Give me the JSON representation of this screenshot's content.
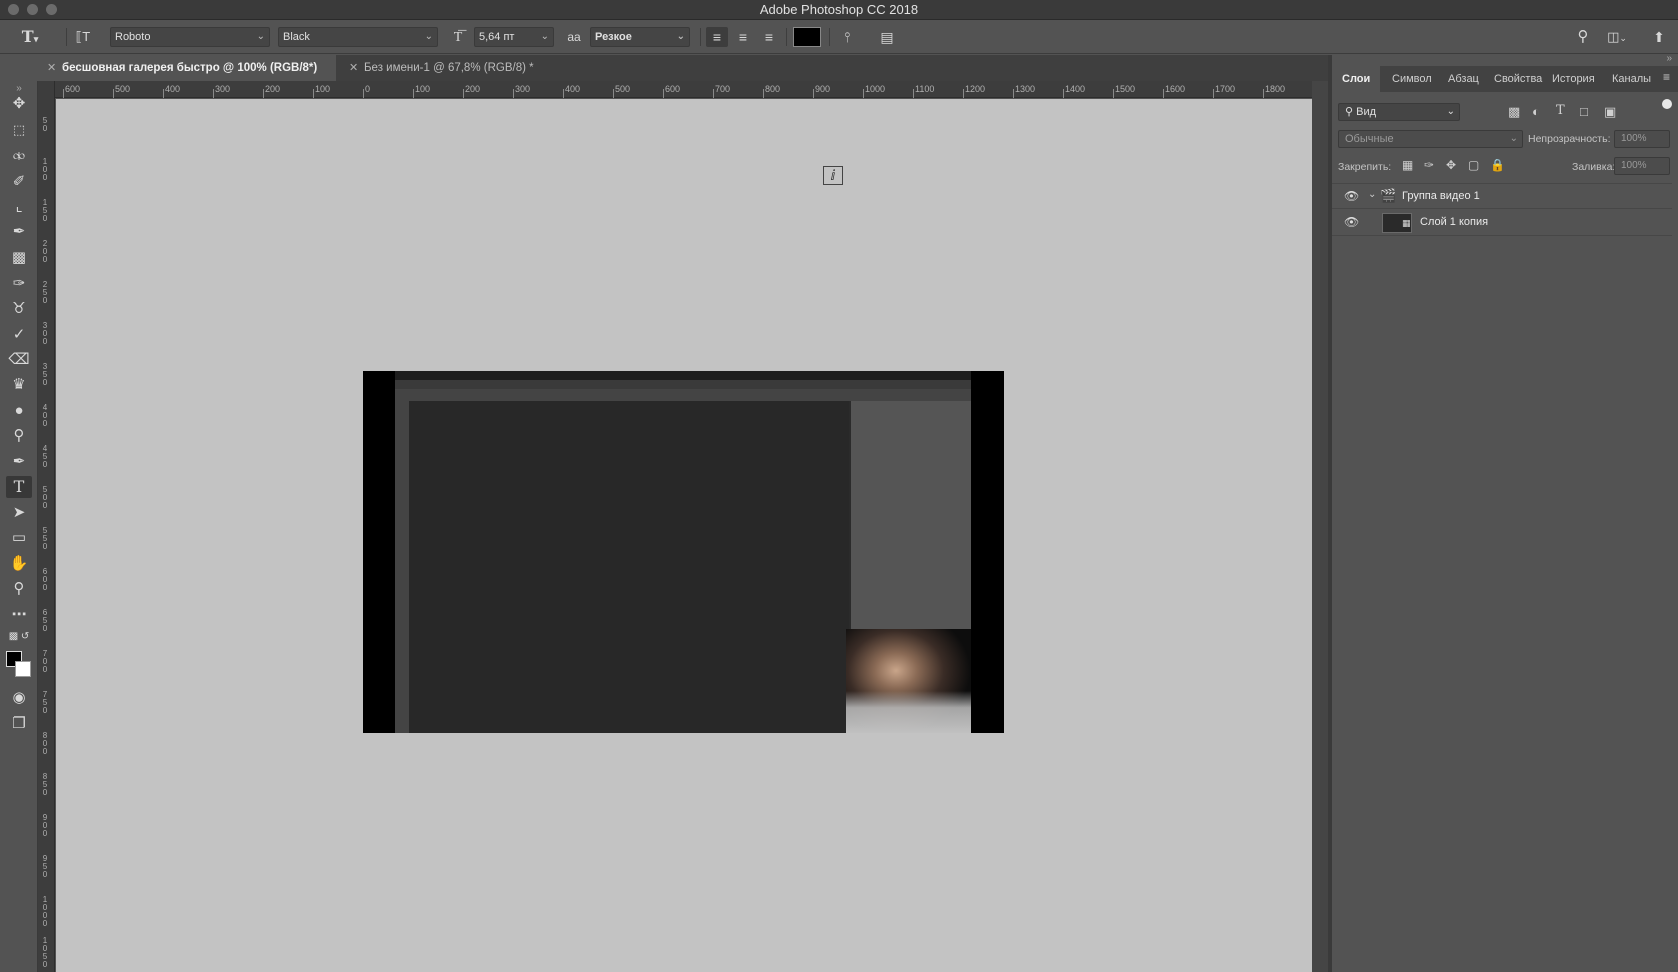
{
  "window": {
    "title": "Adobe Photoshop CC 2018"
  },
  "options_bar": {
    "font_family": "Roboto",
    "font_style": "Black",
    "font_size": "5,64 пт",
    "anti_alias_icon": "aa",
    "anti_alias": "Резкое",
    "text_color": "#000000"
  },
  "tabs": [
    {
      "label": "бесшовная галерея быстро @ 100% (RGB/8*) *",
      "active": true
    },
    {
      "label": "Без имени-1 @ 67,8% (RGB/8) *",
      "active": false
    }
  ],
  "ruler_h": [
    "600",
    "500",
    "400",
    "300",
    "200",
    "100",
    "0",
    "100",
    "200",
    "300",
    "400",
    "500",
    "600",
    "700",
    "800",
    "900",
    "1000",
    "1100",
    "1200",
    "1300",
    "1400",
    "1500",
    "1600",
    "1700",
    "1800"
  ],
  "ruler_v": [
    "5\n0",
    "1\n0\n0",
    "1\n5\n0",
    "2\n0\n0",
    "2\n5\n0",
    "3\n0\n0",
    "3\n5\n0",
    "4\n0\n0",
    "4\n5\n0",
    "5\n0\n0",
    "5\n5\n0",
    "6\n0\n0",
    "6\n5\n0",
    "7\n0\n0",
    "7\n5\n0",
    "8\n0\n0",
    "8\n5\n0",
    "9\n0\n0",
    "9\n5\n0",
    "1\n0\n0\n0",
    "1\n0\n5\n0"
  ],
  "panel": {
    "tabs": [
      "Слои",
      "Символ",
      "Абзац",
      "Свойства",
      "История",
      "Каналы"
    ],
    "filter_label": "Вид",
    "blend_mode": "Обычные",
    "opacity_label": "Непрозрачность:",
    "opacity_value": "100%",
    "lock_label": "Закрепить:",
    "fill_label": "Заливка:",
    "fill_value": "100%",
    "layers": [
      {
        "name": "Группа видео 1",
        "type": "group"
      },
      {
        "name": "Слой 1 копия",
        "type": "video"
      }
    ]
  }
}
